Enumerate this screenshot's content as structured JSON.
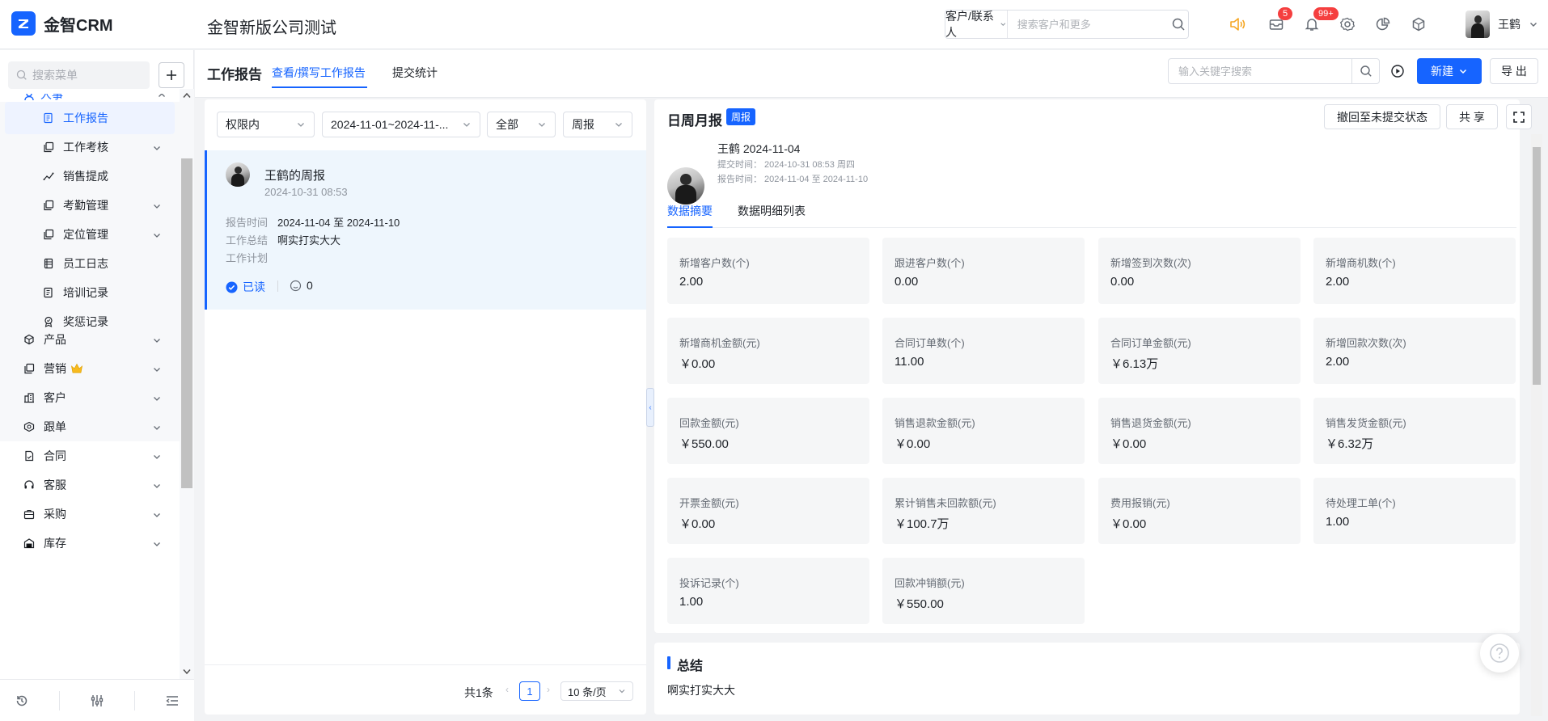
{
  "app": {
    "name": "金智CRM",
    "company": "金智新版公司测试"
  },
  "header": {
    "search_scope": "客户/联系人",
    "search_placeholder": "搜索客户和更多",
    "mail_badge": "5",
    "notification_badge": "99+",
    "user_name": "王鹤"
  },
  "sidebar": {
    "search_placeholder": "搜索菜单",
    "partial_group": "人事",
    "subitems": [
      {
        "label": "工作报告",
        "icon": "report-icon",
        "active": true
      },
      {
        "label": "工作考核",
        "icon": "copy-icon",
        "expandable": true
      },
      {
        "label": "销售提成",
        "icon": "trend-icon"
      },
      {
        "label": "考勤管理",
        "icon": "copy-icon",
        "expandable": true
      },
      {
        "label": "定位管理",
        "icon": "copy-icon",
        "expandable": true
      },
      {
        "label": "员工日志",
        "icon": "log-icon"
      },
      {
        "label": "培训记录",
        "icon": "report-icon"
      },
      {
        "label": "奖惩记录",
        "icon": "award-icon"
      }
    ],
    "groups": [
      {
        "label": "产品",
        "icon": "box-icon"
      },
      {
        "label": "营销",
        "icon": "copy-icon",
        "crown": true
      },
      {
        "label": "客户",
        "icon": "customer-icon"
      },
      {
        "label": "跟单",
        "icon": "follow-icon"
      },
      {
        "label": "合同",
        "icon": "contract-icon"
      },
      {
        "label": "客服",
        "icon": "headset-icon"
      },
      {
        "label": "采购",
        "icon": "purchase-icon"
      },
      {
        "label": "库存",
        "icon": "warehouse-icon"
      }
    ]
  },
  "page": {
    "title": "工作报告",
    "tabs": [
      "查看/撰写工作报告",
      "提交统计"
    ],
    "keyword_placeholder": "输入关键字搜索",
    "new_label": "新建",
    "export_label": "导 出"
  },
  "list": {
    "filters": [
      "权限内",
      "2024-11-01~2024-11-...",
      "全部",
      "周报"
    ],
    "card": {
      "title": "王鹤的周报",
      "created": "2024-10-31 08:53",
      "report_time_label": "报告时间",
      "report_time": "2024-11-04 至 2024-11-10",
      "summary_label": "工作总结",
      "summary": "啊实打实大大",
      "plan_label": "工作计划",
      "read_label": "已读",
      "comment_count": "0"
    },
    "pagination": {
      "total": "共1条",
      "page": "1",
      "page_size": "10 条/页"
    }
  },
  "detail": {
    "title": "日周月报",
    "badge": "周报",
    "withdraw_label": "撤回至未提交状态",
    "share_label": "共 享",
    "user_line": "王鹤 2024-11-04",
    "submit_time": "提交时间：  2024-10-31 08:53 周四",
    "report_time": "报告时间：  2024-11-04 至 2024-11-10",
    "tabs": [
      "数据摘要",
      "数据明细列表"
    ],
    "stats": [
      {
        "label": "新增客户数(个)",
        "value": "2.00"
      },
      {
        "label": "跟进客户数(个)",
        "value": "0.00"
      },
      {
        "label": "新增签到次数(次)",
        "value": "0.00"
      },
      {
        "label": "新增商机数(个)",
        "value": "2.00"
      },
      {
        "label": "新增商机金额(元)",
        "value": "￥0.00"
      },
      {
        "label": "合同订单数(个)",
        "value": "11.00"
      },
      {
        "label": "合同订单金额(元)",
        "value": "￥6.13万"
      },
      {
        "label": "新增回款次数(次)",
        "value": "2.00"
      },
      {
        "label": "回款金额(元)",
        "value": "￥550.00"
      },
      {
        "label": "销售退款金额(元)",
        "value": "￥0.00"
      },
      {
        "label": "销售退货金额(元)",
        "value": "￥0.00"
      },
      {
        "label": "销售发货金额(元)",
        "value": "￥6.32万"
      },
      {
        "label": "开票金额(元)",
        "value": "￥0.00"
      },
      {
        "label": "累计销售未回款额(元)",
        "value": "￥100.7万"
      },
      {
        "label": "费用报销(元)",
        "value": "￥0.00"
      },
      {
        "label": "待处理工单(个)",
        "value": "1.00"
      },
      {
        "label": "投诉记录(个)",
        "value": "1.00"
      },
      {
        "label": "回款冲销额(元)",
        "value": "￥550.00"
      }
    ],
    "summary_title": "总结",
    "summary_text": "啊实打实大大"
  },
  "colors": {
    "primary": "#1664ff",
    "badge_red": "#f53f3f",
    "accent_orange": "#f5a623"
  }
}
